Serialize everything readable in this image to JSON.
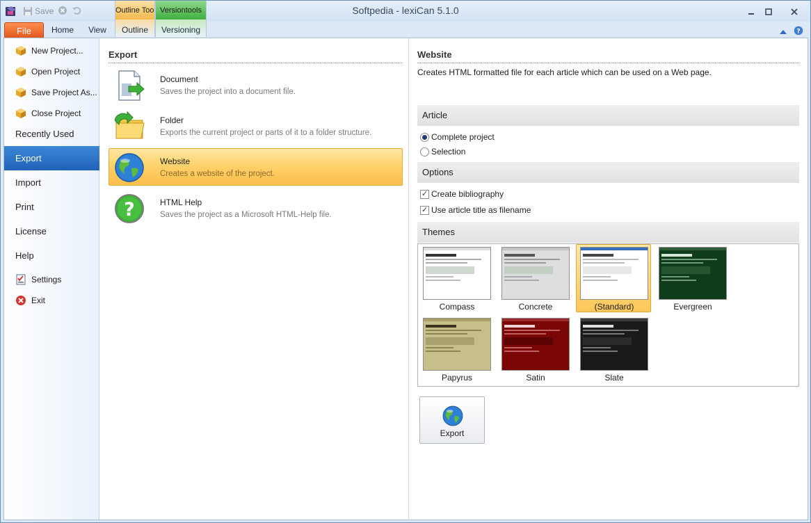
{
  "window": {
    "title": "Softpedia - lexiCan 5.1.0"
  },
  "qat": {
    "save_label": "Save"
  },
  "context_tabs": {
    "outline_group": "Outline Too...",
    "version_group": "Versiontools"
  },
  "tabs": {
    "file": "File",
    "home": "Home",
    "view": "View",
    "outline": "Outline",
    "versioning": "Versioning"
  },
  "sidebar": {
    "new_project": "New Project...",
    "open_project": "Open Project",
    "save_project_as": "Save Project As...",
    "close_project": "Close Project",
    "recently_used": "Recently Used",
    "export": "Export",
    "import": "Import",
    "print": "Print",
    "license": "License",
    "help": "Help",
    "settings": "Settings",
    "exit": "Exit"
  },
  "export_panel": {
    "title": "Export",
    "items": [
      {
        "name": "Document",
        "desc": "Saves the project into a document file."
      },
      {
        "name": "Folder",
        "desc": "Exports the current project or parts of it to a folder structure."
      },
      {
        "name": "Website",
        "desc": "Creates a website of the project."
      },
      {
        "name": "HTML Help",
        "desc": "Saves the project as a Microsoft HTML-Help file."
      }
    ]
  },
  "website_panel": {
    "title": "Website",
    "description": "Creates HTML formatted file for each article which can be used on a Web page.",
    "article_group": "Article",
    "complete_project": "Complete project",
    "selection": "Selection",
    "options_group": "Options",
    "create_bibliography": "Create bibliography",
    "use_article_title": "Use article title as filename",
    "themes_group": "Themes",
    "themes": [
      {
        "name": "Compass"
      },
      {
        "name": "Concrete"
      },
      {
        "name": "(Standard)"
      },
      {
        "name": "Evergreen"
      },
      {
        "name": "Papyrus"
      },
      {
        "name": "Satin"
      },
      {
        "name": "Slate"
      }
    ],
    "export_button": "Export"
  },
  "colors": {
    "file_tab": "#e2561c",
    "selected_sidebar": "#2570c6",
    "selected_item": "#ffd26b"
  }
}
